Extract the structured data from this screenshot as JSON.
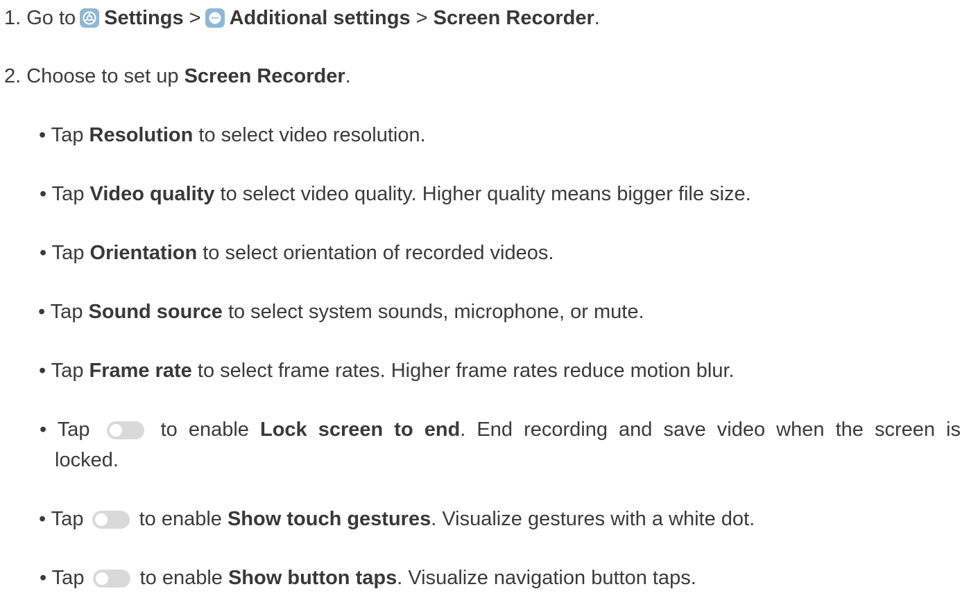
{
  "steps": [
    {
      "num": "1. Go to",
      "parts": {
        "settings": "Settings",
        "sep1": ">",
        "additional": "Additional settings",
        "sep2": ">",
        "recorder": "Screen Recorder",
        "end": "."
      }
    },
    {
      "num": "2. Choose to set up",
      "bold": "Screen Recorder",
      "end": "."
    }
  ],
  "bullets": [
    {
      "prefix": "• Tap",
      "bold": "Resolution",
      "rest": "to select video resolution."
    },
    {
      "prefix": "• Tap",
      "bold": "Video quality",
      "rest": "to select video quality. Higher quality means bigger file size."
    },
    {
      "prefix": "• Tap",
      "bold": "Orientation",
      "rest": "to select orientation of recorded videos."
    },
    {
      "prefix": "• Tap",
      "bold": "Sound source",
      "rest": "to select system sounds, microphone, or mute."
    },
    {
      "prefix": "• Tap",
      "bold": "Frame rate",
      "rest": "to select frame rates. Higher frame rates reduce motion blur."
    },
    {
      "prefix": "• Tap",
      "mid": "to enable",
      "bold": "Lock screen to end",
      "rest": ". End recording and save video when the screen is",
      "cont": "locked."
    },
    {
      "prefix": "• Tap",
      "mid": "to enable",
      "bold": "Show touch gestures",
      "rest": ". Visualize gestures with a white dot."
    },
    {
      "prefix": "• Tap",
      "mid": "to enable",
      "bold": "Show button taps",
      "rest": ". Visualize navigation button taps."
    }
  ],
  "icons": {
    "settings": "settings-gear-icon",
    "additional": "more-dots-icon",
    "toggle": "toggle-switch-off-icon"
  },
  "colors": {
    "icon_bg": "#8fb8d2",
    "toggle_off": "#d9d9d9",
    "text": "#3a3a3a"
  }
}
